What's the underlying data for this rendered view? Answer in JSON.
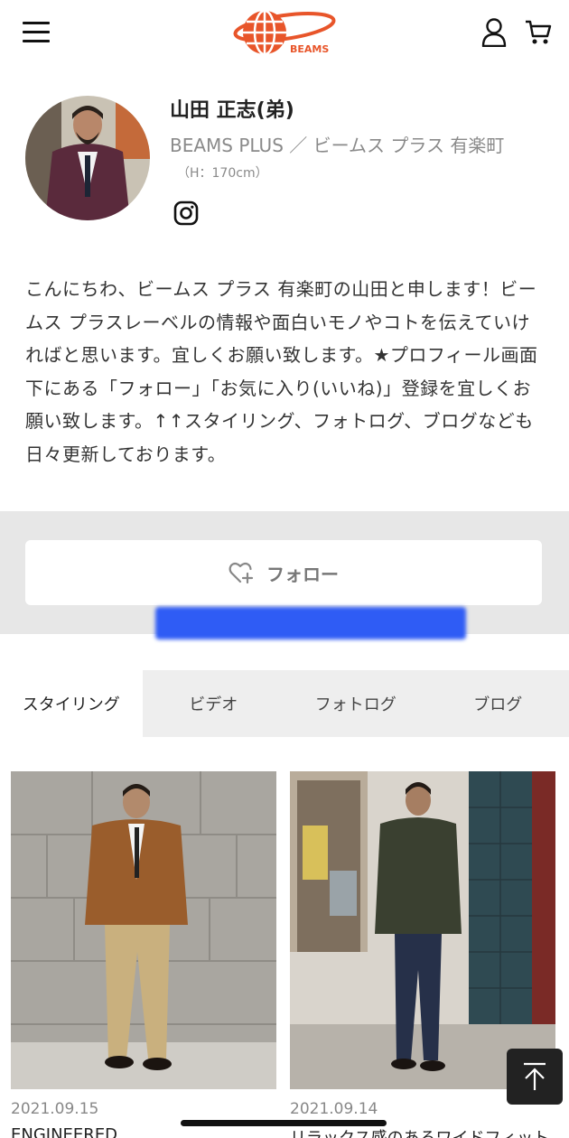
{
  "header": {
    "logo_text": "BEAMS"
  },
  "profile": {
    "name": "山田 正志(弟)",
    "shop": "BEAMS PLUS ／ ビームス プラス 有楽町",
    "height": "（H：170cm）",
    "bio": "こんにちわ、ビームス プラス 有楽町の山田と申します！ビームス プラスレーベルの情報や面白いモノやコトを伝えていければと思います。宜しくお願い致します。★プロフィール画面下にある「フォロー」「お気に入り(いいね)」登録を宜しくお願い致します。↑↑スタイリング、フォトログ、ブログなども日々更新しております。"
  },
  "follow": {
    "label": "フォロー"
  },
  "tabs": [
    {
      "label": "スタイリング",
      "active": true
    },
    {
      "label": "ビデオ",
      "active": false
    },
    {
      "label": "フォトログ",
      "active": false
    },
    {
      "label": "ブログ",
      "active": false
    }
  ],
  "cards": [
    {
      "date": "2021.09.15",
      "title": "ENGINEERED"
    },
    {
      "date": "2021.09.14",
      "title": "リラックス感のあるワイドフィット"
    }
  ],
  "colors": {
    "logo_orange": "#e8552a",
    "redaction_blue": "#2f5cf5",
    "band_gray": "#e7e7e7"
  }
}
